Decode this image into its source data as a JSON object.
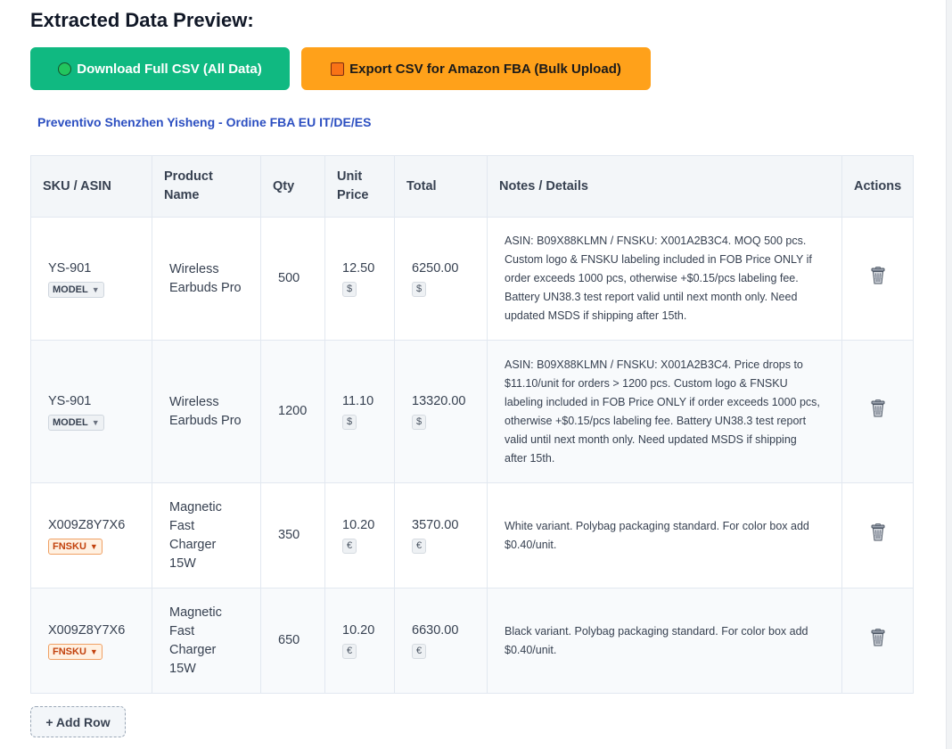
{
  "heading": "Extracted Data Preview:",
  "buttons": {
    "download_full_csv": "Download Full CSV (All Data)",
    "export_amazon_fba": "Export CSV for Amazon FBA (Bulk Upload)",
    "add_row": "+ Add Row"
  },
  "quote_title": "Preventivo Shenzhen Yisheng - Ordine FBA EU IT/DE/ES",
  "table": {
    "headers": {
      "sku": "SKU / ASIN",
      "product_line1": "Product",
      "product_line2": "Name",
      "qty": "Qty",
      "unit_line1": "Unit",
      "unit_line2": "Price",
      "total": "Total",
      "notes": "Notes / Details",
      "actions": "Actions"
    },
    "rows": [
      {
        "sku": "YS-901",
        "sku_type": "MODEL",
        "product_lines": [
          "Wireless",
          "Earbuds Pro"
        ],
        "qty": "500",
        "unit_price": "12.50",
        "unit_currency": "$",
        "total": "6250.00",
        "total_currency": "$",
        "notes_lines": [
          "ASIN: B09X88KLMN / FNSKU: X001A2B3C4. MOQ 500 pcs.",
          "Custom logo & FNSKU labeling included in FOB Price ONLY if",
          "order exceeds 1000 pcs, otherwise +$0.15/pcs labeling fee.",
          "Battery UN38.3 test report valid until next month only. Need",
          "updated MSDS if shipping after 15th."
        ]
      },
      {
        "sku": "YS-901",
        "sku_type": "MODEL",
        "product_lines": [
          "Wireless",
          "Earbuds Pro"
        ],
        "qty": "1200",
        "unit_price": "11.10",
        "unit_currency": "$",
        "total": "13320.00",
        "total_currency": "$",
        "notes_lines": [
          "ASIN: B09X88KLMN / FNSKU: X001A2B3C4. Price drops to",
          "$11.10/unit for orders > 1200 pcs. Custom logo & FNSKU",
          "labeling included in FOB Price ONLY if order exceeds 1000 pcs,",
          "otherwise +$0.15/pcs labeling fee. Battery UN38.3 test report",
          "valid until next month only. Need updated MSDS if shipping",
          "after 15th."
        ]
      },
      {
        "sku": "X009Z8Y7X6",
        "sku_type": "FNSKU",
        "product_lines": [
          "Magnetic",
          "Fast",
          "Charger",
          "15W"
        ],
        "qty": "350",
        "unit_price": "10.20",
        "unit_currency": "€",
        "total": "3570.00",
        "total_currency": "€",
        "notes_lines": [
          "White variant. Polybag packaging standard. For color box add",
          "$0.40/unit."
        ]
      },
      {
        "sku": "X009Z8Y7X6",
        "sku_type": "FNSKU",
        "product_lines": [
          "Magnetic",
          "Fast",
          "Charger",
          "15W"
        ],
        "qty": "650",
        "unit_price": "10.20",
        "unit_currency": "€",
        "total": "6630.00",
        "total_currency": "€",
        "notes_lines": [
          "Black variant. Polybag packaging standard. For color box add",
          "$0.40/unit."
        ]
      }
    ]
  },
  "icons": {
    "download": "green-circle-icon",
    "export": "orange-square-icon",
    "delete": "trash-icon"
  },
  "colors": {
    "download_button": "#10b981",
    "export_button": "#ffa11a",
    "quote_title": "#2c4fc1"
  }
}
